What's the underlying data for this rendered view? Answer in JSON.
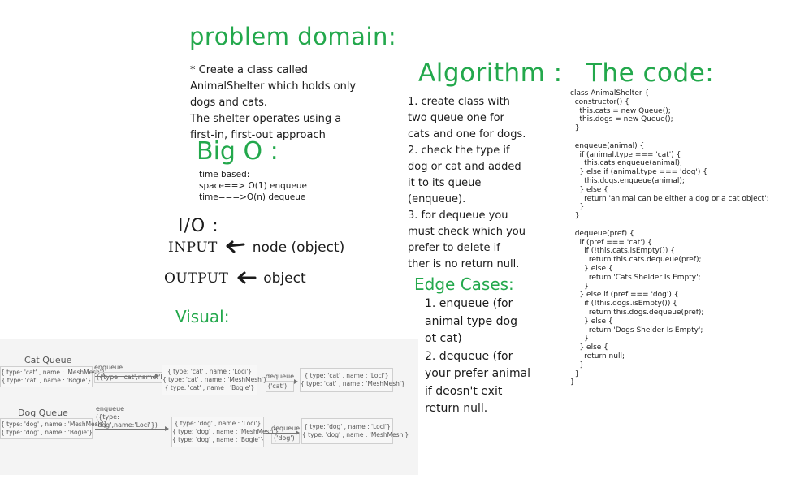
{
  "problem": {
    "title": "problem domain:",
    "lines": [
      "* Create a class called",
      "AnimalShelter which holds only",
      "dogs and cats.",
      "The shelter operates using a",
      "first-in, first-out approach"
    ]
  },
  "bigo": {
    "title": "Big O :",
    "lines": [
      "time based:",
      "space==> O(1) enqueue",
      "time===>O(n) dequeue"
    ]
  },
  "io": {
    "title": "I/O :",
    "input_label": "INPUT",
    "input_value": "node (object)",
    "output_label": "OUTPUT",
    "output_value": "object"
  },
  "visual": {
    "title": "Visual:"
  },
  "algorithm": {
    "title": "Algorithm :",
    "lines": [
      "1. create class with",
      "two queue one for",
      "cats and one for dogs.",
      "2. check the type if",
      "dog or cat and added",
      "it to its queue",
      "(enqueue).",
      "3. for dequeue you",
      "must check which you",
      "prefer to delete if",
      "ther is no return null."
    ]
  },
  "edge": {
    "title": "Edge Cases:",
    "lines": [
      "1. enqueue (for",
      "animal type dog",
      "ot cat)",
      "2. dequeue (for",
      "your prefer animal",
      "if deosn't exit",
      "return null."
    ]
  },
  "code": {
    "title": "The code:",
    "text": "class AnimalShelter {\n  constructor() {\n    this.cats = new Queue();\n    this.dogs = new Queue();\n  }\n\n  enqueue(animal) {\n    if (animal.type === 'cat') {\n      this.cats.enqueue(animal);\n    } else if (animal.type === 'dog') {\n      this.dogs.enqueue(animal);\n    } else {\n      return 'animal can be either a dog or a cat object';\n    }\n  }\n\n  dequeue(pref) {\n    if (pref === 'cat') {\n      if (!this.cats.isEmpty()) {\n        return this.cats.dequeue(pref);\n      } else {\n        return 'Cats Shelder Is Empty';\n      }\n    } else if (pref === 'dog') {\n      if (!this.dogs.isEmpty()) {\n        return this.dogs.dequeue(pref);\n      } else {\n        return 'Dogs Shelder Is Empty';\n      }\n    } else {\n      return null;\n    }\n  }\n}"
  },
  "diagram": {
    "cat_queue_title": "Cat Queue",
    "cat_initial": [
      "{ type: 'cat' , name : 'MeshMesh'}",
      "{ type: 'cat' , name : 'Bogie'}"
    ],
    "cat_enqueue_label": [
      "enqueue",
      "({type: 'cat',name:'Loci'})"
    ],
    "cat_after_enqueue": [
      "{ type: 'cat' , name : 'Loci'}",
      "{ type: 'cat' , name : 'MeshMesh'}",
      "{ type: 'cat' , name : 'Bogie'}"
    ],
    "cat_dequeue_label": [
      "dequeue",
      "('cat')"
    ],
    "cat_after_dequeue": [
      "{ type: 'cat' , name : 'Loci'}",
      "{ type: 'cat' , name : 'MeshMesh'}"
    ],
    "dog_queue_title": "Dog Queue",
    "dog_initial": [
      "{ type: 'dog' , name : 'MeshMesh'}",
      "{ type: 'dog' , name : 'Bogie'}"
    ],
    "dog_enqueue_label": [
      "enqueue",
      "({type:",
      "'dog',name:'Loci'})"
    ],
    "dog_after_enqueue": [
      "{ type: 'dog' , name : 'Loci'}",
      "{ type: 'dog' , name : 'MeshMesh'}",
      "{ type: 'dog' , name : 'Bogie'}"
    ],
    "dog_dequeue_label": [
      "dequeue",
      "('dog')"
    ],
    "dog_after_dequeue": [
      "{ type: 'dog' , name : 'Loci'}",
      "{ type: 'dog' , name : 'MeshMesh'}"
    ]
  },
  "colors": {
    "accent_green": "#23a84c",
    "ink": "#1b1b1b",
    "diagram_bg": "#f4f4f4"
  }
}
